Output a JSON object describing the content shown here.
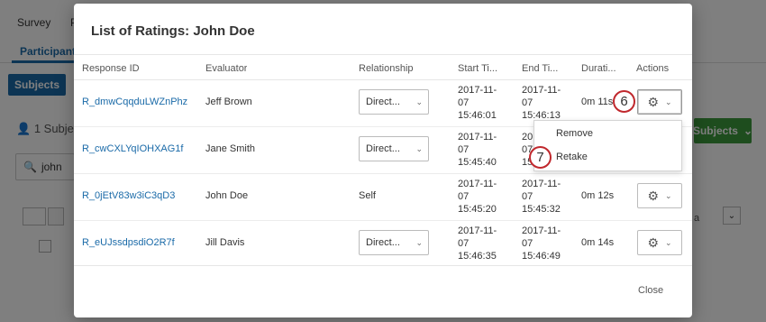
{
  "background": {
    "top_nav": {
      "survey": "Survey",
      "second_initial": "P"
    },
    "tabs": {
      "participants": "Participants"
    },
    "subjects_button": "Subjects",
    "subjects_count": "1 Subjec",
    "search_value": "john",
    "green_button": "Subjects",
    "right_text": "a"
  },
  "modal": {
    "title": "List of Ratings: John Doe",
    "columns": [
      "Response ID",
      "Evaluator",
      "Relationship",
      "Start Ti...",
      "End Ti...",
      "Durati...",
      "Actions"
    ],
    "rows": [
      {
        "response_id": "R_dmwCqqduLWZnPhz",
        "evaluator": "Jeff Brown",
        "relationship": "Direct...",
        "start": [
          "2017-11-",
          "07",
          "15:46:01"
        ],
        "end": [
          "2017-11-",
          "07",
          "15:46:13"
        ],
        "duration": "0m 11s"
      },
      {
        "response_id": "R_cwCXLYqIOHXAG1f",
        "evaluator": "Jane Smith",
        "relationship": "Direct...",
        "start": [
          "2017-11-",
          "07",
          "15:45:40"
        ],
        "end": [
          "2017-11-",
          "07",
          "15:45:51"
        ],
        "duration": ""
      },
      {
        "response_id": "R_0jEtV83w3iC3qD3",
        "evaluator": "John Doe",
        "relationship": "Self",
        "start": [
          "2017-11-",
          "07",
          "15:45:20"
        ],
        "end": [
          "2017-11-",
          "07",
          "15:45:32"
        ],
        "duration": "0m 12s"
      },
      {
        "response_id": "R_eUJssdpsdiO2R7f",
        "evaluator": "Jill Davis",
        "relationship": "Direct...",
        "start": [
          "2017-11-",
          "07",
          "15:46:35"
        ],
        "end": [
          "2017-11-",
          "07",
          "15:46:49"
        ],
        "duration": "0m 14s"
      }
    ],
    "menu": {
      "remove": "Remove",
      "retake": "Retake"
    },
    "close": "Close"
  },
  "callouts": {
    "first": "6",
    "second": "7"
  },
  "icons": {
    "gear": "gear-icon",
    "chevron": "chevron-down-icon",
    "search": "search-icon",
    "user": "user-icon"
  },
  "colors": {
    "link": "#1a6aa8",
    "green": "#3d9a3d",
    "callout_border": "#c0282d"
  }
}
